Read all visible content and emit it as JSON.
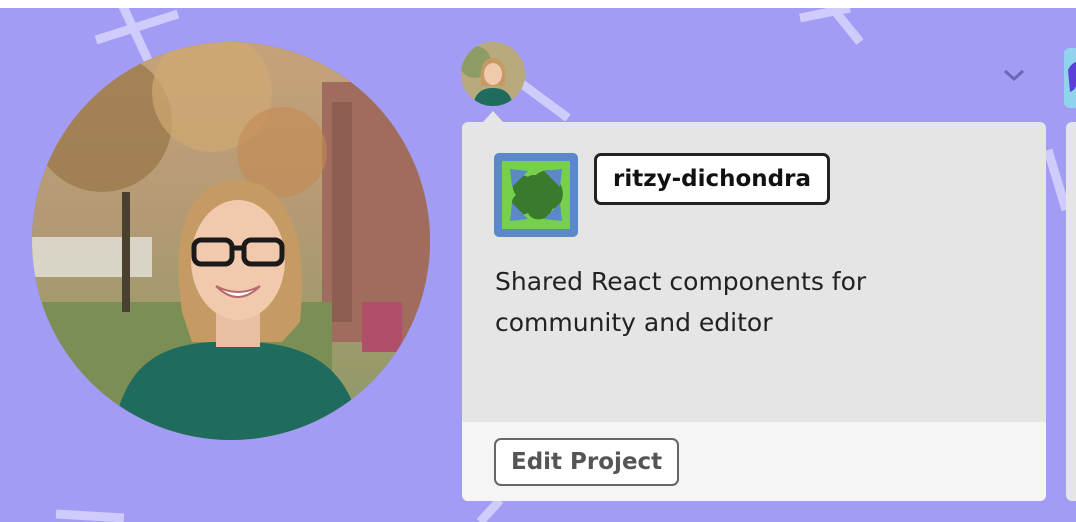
{
  "project": {
    "name": "ritzy-dichondra",
    "description": "Shared React components for community and editor",
    "edit_label": "Edit Project"
  },
  "colors": {
    "background": "#a29cf4",
    "card": "#e5e5e5",
    "card_footer": "#f5f5f5",
    "project_avatar_blue": "#5a88c8",
    "project_avatar_green": "#76d04c"
  },
  "icons": {
    "expand": "chevron-down-icon"
  }
}
